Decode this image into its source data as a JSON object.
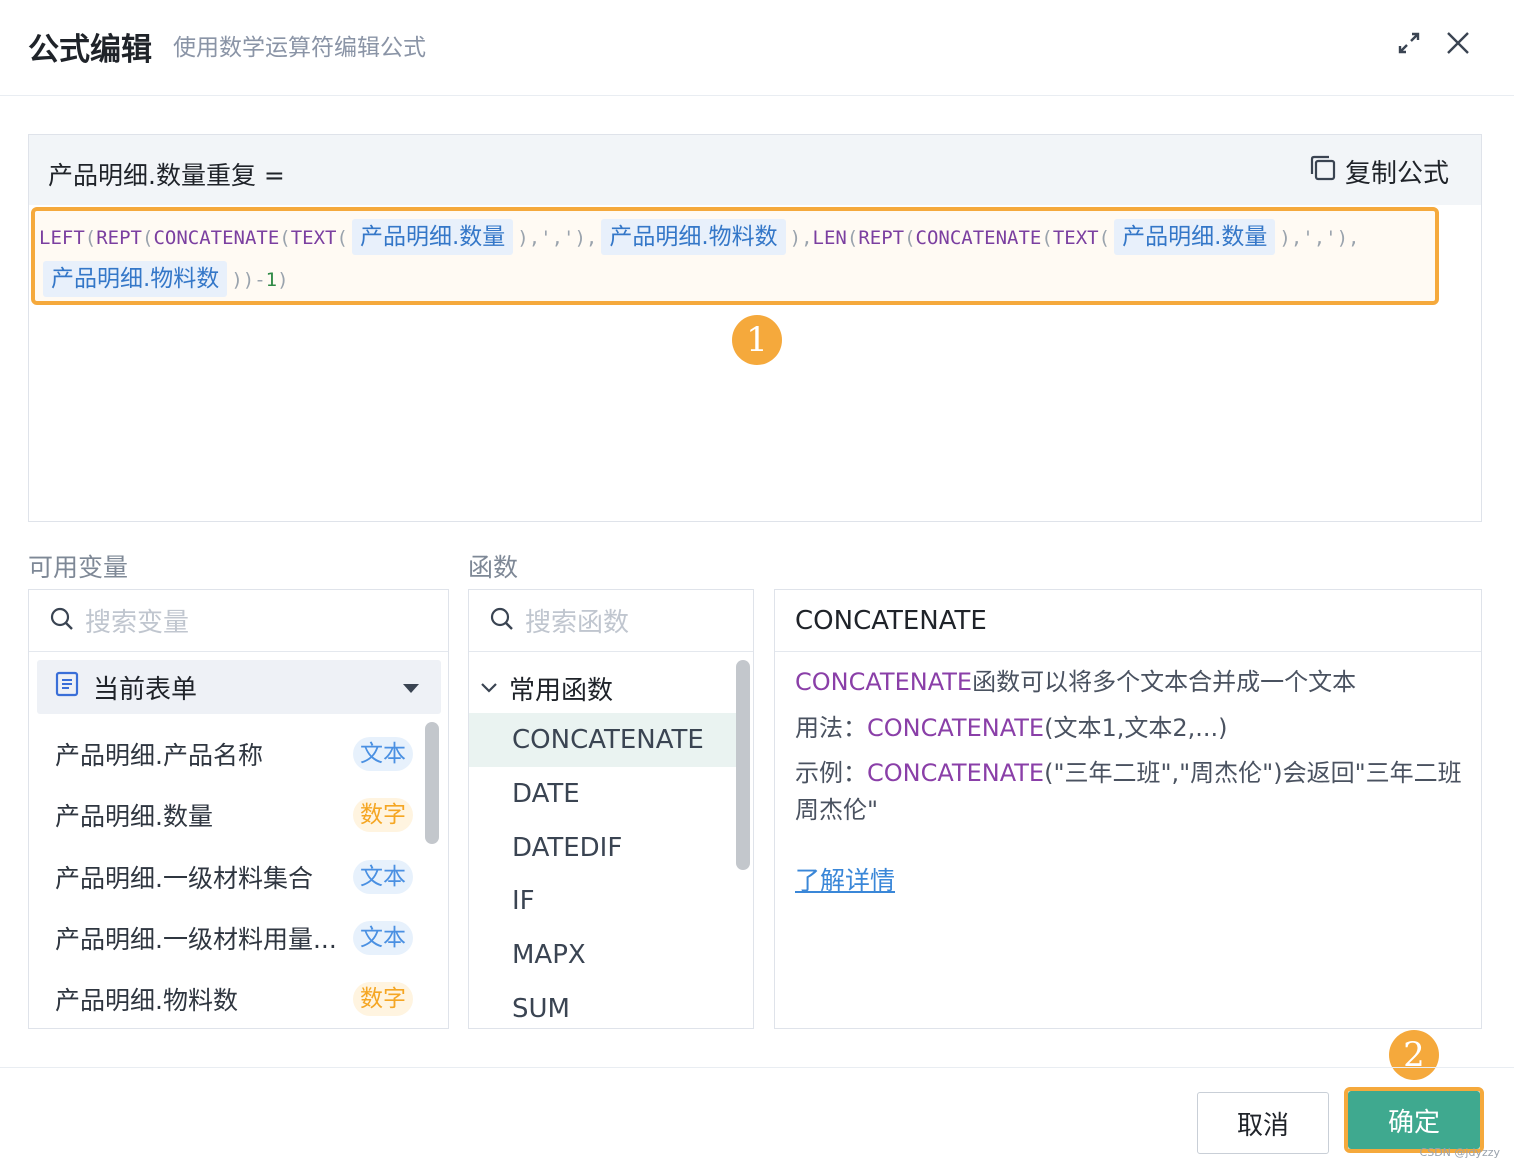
{
  "header": {
    "title": "公式编辑",
    "subtitle": "使用数学运算符编辑公式"
  },
  "editor": {
    "field_name": "产品明细.数量重复 =",
    "copy_label": "复制公式",
    "formula": {
      "line1": [
        {
          "t": "fn",
          "v": "LEFT"
        },
        {
          "t": "pn",
          "v": "("
        },
        {
          "t": "fn",
          "v": "REPT"
        },
        {
          "t": "pn",
          "v": "("
        },
        {
          "t": "fn",
          "v": "CONCATENATE"
        },
        {
          "t": "pn",
          "v": "("
        },
        {
          "t": "fn",
          "v": "TEXT"
        },
        {
          "t": "pn",
          "v": "("
        },
        {
          "t": "var",
          "v": "产品明细.数量"
        },
        {
          "t": "pn",
          "v": "),','),"
        },
        {
          "t": "var",
          "v": "产品明细.物料数"
        },
        {
          "t": "pn",
          "v": "),"
        },
        {
          "t": "fn",
          "v": "LEN"
        },
        {
          "t": "pn",
          "v": "("
        },
        {
          "t": "fn",
          "v": "REPT"
        },
        {
          "t": "pn",
          "v": "("
        },
        {
          "t": "fn",
          "v": "CONCATENATE"
        },
        {
          "t": "pn",
          "v": "("
        },
        {
          "t": "fn",
          "v": "TEXT"
        },
        {
          "t": "pn",
          "v": "("
        },
        {
          "t": "var",
          "v": "产品明细.数量"
        },
        {
          "t": "pn",
          "v": "),','),"
        }
      ],
      "line2": [
        {
          "t": "var",
          "v": "产品明细.物料数"
        },
        {
          "t": "pn",
          "v": "))-"
        },
        {
          "t": "num",
          "v": "1"
        },
        {
          "t": "pn",
          "v": ")"
        }
      ]
    }
  },
  "annotations": {
    "badge1": "1",
    "badge2": "2"
  },
  "variables": {
    "section_label": "可用变量",
    "search_placeholder": "搜索变量",
    "form_select": "当前表单",
    "items": [
      {
        "label": "产品明细.产品名称",
        "tag": "文本"
      },
      {
        "label": "产品明细.数量",
        "tag": "数字"
      },
      {
        "label": "产品明细.一级材料集合",
        "tag": "文本"
      },
      {
        "label": "产品明细.一级材料用量...",
        "tag": "文本"
      },
      {
        "label": "产品明细.物料数",
        "tag": "数字"
      }
    ]
  },
  "functions": {
    "section_label": "函数",
    "search_placeholder": "搜索函数",
    "group": "常用函数",
    "items": [
      "CONCATENATE",
      "DATE",
      "DATEDIF",
      "IF",
      "MAPX",
      "SUM"
    ],
    "active": "CONCATENATE"
  },
  "description": {
    "title": "CONCATENATE",
    "fn_name": "CONCATENATE",
    "summary": "函数可以将多个文本合并成一个文本",
    "usage_label": "用法：",
    "usage_args": "(文本1,文本2,...)",
    "example_label": "示例：",
    "example_line1": "(\"三年二班\",\"周杰伦\")会返回\"三年二班",
    "example_line2": "周杰伦\"",
    "learn_more": "了解详情"
  },
  "footer": {
    "cancel": "取消",
    "ok": "确定",
    "watermark": "CSDN @jdyzzy"
  },
  "colors": {
    "accent": "#3fa98f",
    "highlight": "#f5a93c",
    "function": "#7b3fa0",
    "variable": "#3477c8"
  }
}
